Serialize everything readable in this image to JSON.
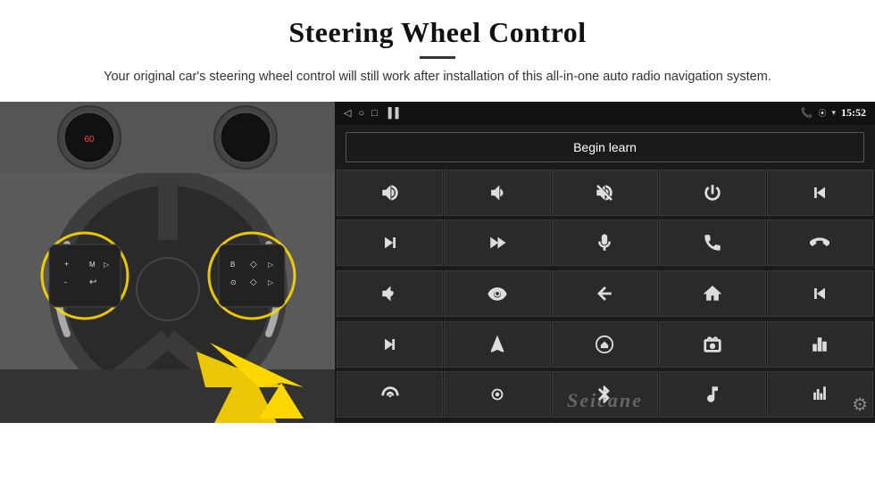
{
  "header": {
    "title": "Steering Wheel Control",
    "subtitle": "Your original car's steering wheel control will still work after installation of this all-in-one auto radio navigation system."
  },
  "android_panel": {
    "status_bar": {
      "time": "15:52",
      "icons": [
        "back-icon",
        "home-icon",
        "recents-icon",
        "sim-icon"
      ]
    },
    "begin_learn_label": "Begin learn",
    "controls": [
      {
        "icon": "vol-up",
        "label": "Volume Up"
      },
      {
        "icon": "vol-down",
        "label": "Volume Down"
      },
      {
        "icon": "vol-mute",
        "label": "Mute"
      },
      {
        "icon": "power",
        "label": "Power"
      },
      {
        "icon": "prev-track",
        "label": "Previous Track"
      },
      {
        "icon": "next-track",
        "label": "Next Track"
      },
      {
        "icon": "skip-fwd",
        "label": "Skip Forward"
      },
      {
        "icon": "mic",
        "label": "Microphone"
      },
      {
        "icon": "phone",
        "label": "Phone"
      },
      {
        "icon": "hang-up",
        "label": "Hang Up"
      },
      {
        "icon": "horn",
        "label": "Horn"
      },
      {
        "icon": "360",
        "label": "360 Camera"
      },
      {
        "icon": "back",
        "label": "Back"
      },
      {
        "icon": "home",
        "label": "Home"
      },
      {
        "icon": "prev-ch",
        "label": "Previous Chapter"
      },
      {
        "icon": "next-ch",
        "label": "Next Chapter"
      },
      {
        "icon": "nav",
        "label": "Navigation"
      },
      {
        "icon": "eject",
        "label": "Eject"
      },
      {
        "icon": "radio",
        "label": "Radio"
      },
      {
        "icon": "eq",
        "label": "Equalizer"
      },
      {
        "icon": "voice",
        "label": "Voice"
      },
      {
        "icon": "settings-ring",
        "label": "Settings"
      },
      {
        "icon": "bluetooth",
        "label": "Bluetooth"
      },
      {
        "icon": "music",
        "label": "Music"
      },
      {
        "icon": "spectrum",
        "label": "Spectrum"
      }
    ],
    "watermark": "Seicane"
  }
}
